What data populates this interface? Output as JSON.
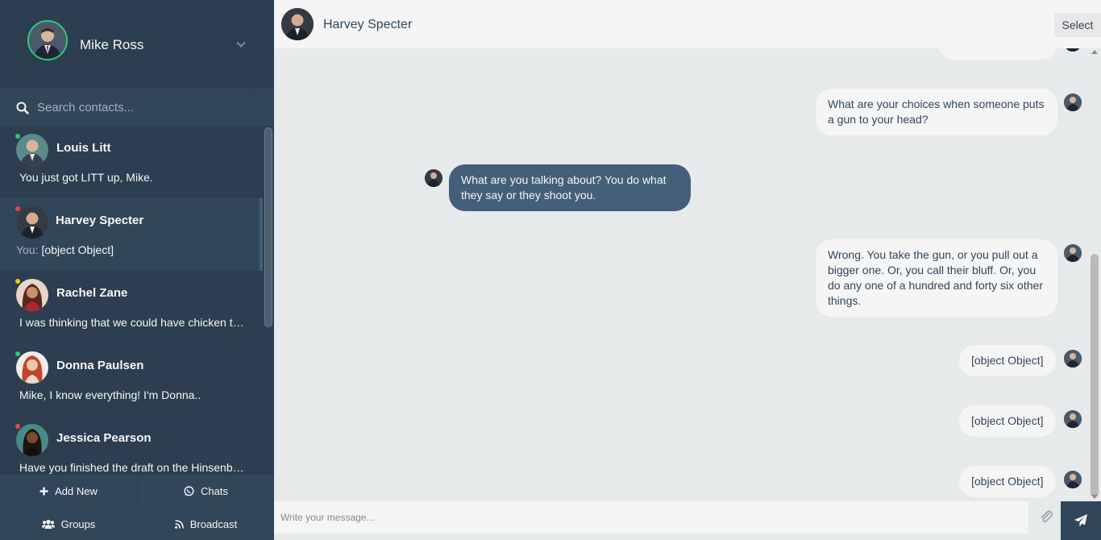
{
  "profile": {
    "name": "Mike Ross",
    "status_color": "#2ecc71"
  },
  "search": {
    "placeholder": "Search contacts..."
  },
  "contacts": [
    {
      "name": "Louis Litt",
      "preview": "You just got LITT up, Mike.",
      "status_color": "#2ecc71",
      "you": ""
    },
    {
      "name": "Harvey Specter",
      "preview": "[object Object]",
      "status_color": "#e74c3c",
      "you": "You:"
    },
    {
      "name": "Rachel Zane",
      "preview": "I was thinking that we could have chicken tonight, sounds good?",
      "status_color": "#f1c40f",
      "you": ""
    },
    {
      "name": "Donna Paulsen",
      "preview": "Mike, I know everything! I'm Donna..",
      "status_color": "#2ecc71",
      "you": ""
    },
    {
      "name": "Jessica Pearson",
      "preview": "Have you finished the draft on the Hinsenburg deal?",
      "status_color": "#e74c3c",
      "you": ""
    }
  ],
  "bottom_bar": {
    "add_new": "Add New",
    "chats": "Chats",
    "groups": "Groups",
    "broadcast": "Broadcast"
  },
  "chat": {
    "contact_name": "Harvey Specter",
    "select_label": "Select",
    "messages": [
      {
        "type": "sent",
        "text": "What are your choices when someone puts a gun to your head?"
      },
      {
        "type": "replies",
        "text": "What are you talking about? You do what they say or they shoot you."
      },
      {
        "type": "sent",
        "text": "Wrong. You take the gun, or you pull out a bigger one. Or, you call their bluff. Or, you do any one of a hundred and forty six other things."
      },
      {
        "type": "sent",
        "text": "[object Object]"
      },
      {
        "type": "sent",
        "text": "[object Object]"
      },
      {
        "type": "sent",
        "text": "[object Object]"
      }
    ]
  },
  "composer": {
    "placeholder": "Write your message..."
  },
  "icons": {
    "search": "search-icon",
    "chevron": "chevron-down-icon",
    "add": "plus-icon",
    "chats": "whatsapp-icon",
    "groups": "users-icon",
    "broadcast": "rss-icon",
    "attach": "paperclip-icon",
    "send": "paper-plane-icon"
  },
  "colors": {
    "sidebar_bg": "#2c3e50",
    "sidebar_panel": "#32465a",
    "active_border": "#435f7a",
    "reply_bubble": "#435f7a",
    "sent_bubble": "#f5f5f5",
    "chat_bg": "#e6eaea"
  }
}
